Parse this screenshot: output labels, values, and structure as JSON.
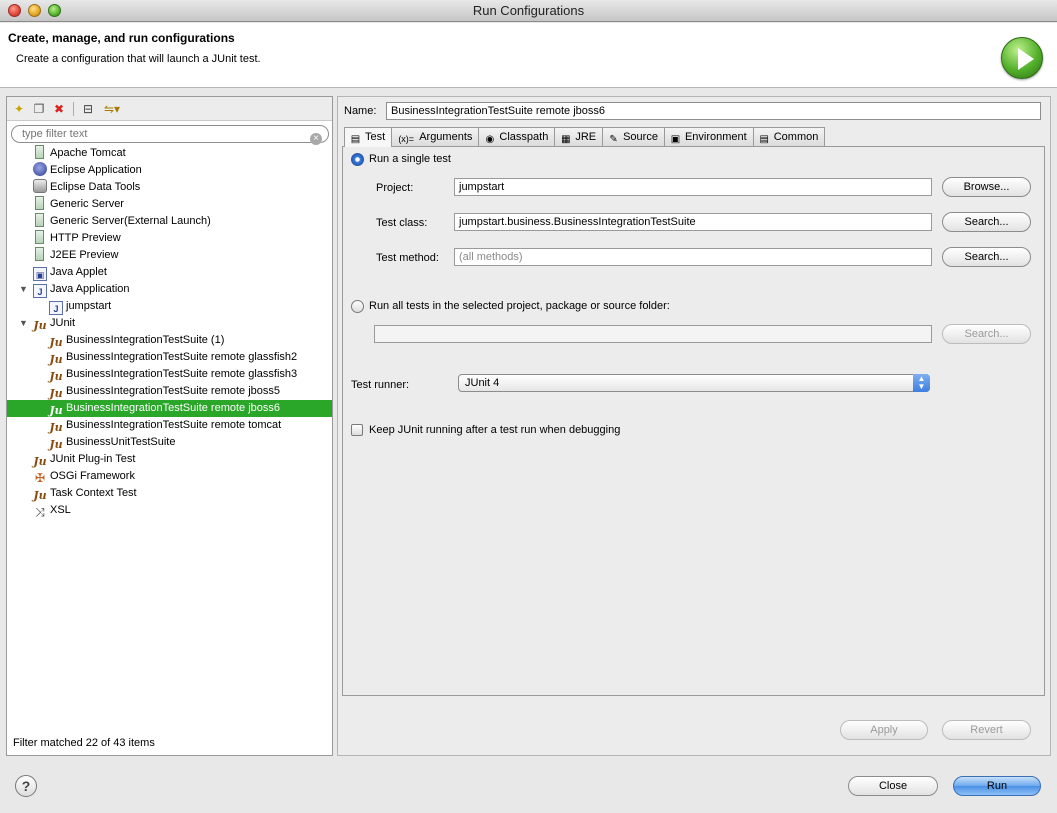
{
  "window": {
    "title": "Run Configurations"
  },
  "header": {
    "title": "Create, manage, and run configurations",
    "description": "Create a configuration that will launch a JUnit test."
  },
  "sidebar": {
    "filter_placeholder": "type filter text",
    "items": [
      {
        "label": "Apache Tomcat",
        "icon": "server-icon",
        "level": 0
      },
      {
        "label": "Eclipse Application",
        "icon": "eclipse-icon",
        "level": 0
      },
      {
        "label": "Eclipse Data Tools",
        "icon": "database-icon",
        "level": 0
      },
      {
        "label": "Generic Server",
        "icon": "server-icon",
        "level": 0
      },
      {
        "label": "Generic Server(External Launch)",
        "icon": "server-icon",
        "level": 0
      },
      {
        "label": "HTTP Preview",
        "icon": "server-icon",
        "level": 0
      },
      {
        "label": "J2EE Preview",
        "icon": "server-icon",
        "level": 0
      },
      {
        "label": "Java Applet",
        "icon": "applet-icon",
        "level": 0
      },
      {
        "label": "Java Application",
        "icon": "java-app-icon",
        "level": 0,
        "expanded": true
      },
      {
        "label": "jumpstart",
        "icon": "java-app-icon",
        "level": 1
      },
      {
        "label": "JUnit",
        "icon": "junit-icon",
        "level": 0,
        "expanded": true
      },
      {
        "label": "BusinessIntegrationTestSuite (1)",
        "icon": "junit-icon",
        "level": 1
      },
      {
        "label": "BusinessIntegrationTestSuite remote glassfish2",
        "icon": "junit-icon",
        "level": 1
      },
      {
        "label": "BusinessIntegrationTestSuite remote glassfish3",
        "icon": "junit-icon",
        "level": 1
      },
      {
        "label": "BusinessIntegrationTestSuite remote jboss5",
        "icon": "junit-icon",
        "level": 1
      },
      {
        "label": "BusinessIntegrationTestSuite remote jboss6",
        "icon": "junit-icon",
        "level": 1,
        "selected": true
      },
      {
        "label": "BusinessIntegrationTestSuite remote tomcat",
        "icon": "junit-icon",
        "level": 1
      },
      {
        "label": "BusinessUnitTestSuite",
        "icon": "junit-icon",
        "level": 1
      },
      {
        "label": "JUnit Plug-in Test",
        "icon": "junit-plugin-icon",
        "level": 0
      },
      {
        "label": "OSGi Framework",
        "icon": "osgi-icon",
        "level": 0
      },
      {
        "label": "Task Context Test",
        "icon": "junit-icon",
        "level": 0
      },
      {
        "label": "XSL",
        "icon": "xsl-icon",
        "level": 0
      }
    ],
    "status": "Filter matched 22 of 43 items"
  },
  "config": {
    "name_label": "Name:",
    "name_value": "BusinessIntegrationTestSuite remote jboss6",
    "tabs": [
      {
        "label": "Test",
        "icon": "test-tab-icon",
        "active": true
      },
      {
        "label": "Arguments",
        "icon": "arguments-icon"
      },
      {
        "label": "Classpath",
        "icon": "classpath-icon"
      },
      {
        "label": "JRE",
        "icon": "jre-icon"
      },
      {
        "label": "Source",
        "icon": "source-icon"
      },
      {
        "label": "Environment",
        "icon": "environment-icon"
      },
      {
        "label": "Common",
        "icon": "common-icon"
      }
    ],
    "test": {
      "run_single_label": "Run a single test",
      "project_label": "Project:",
      "project_value": "jumpstart",
      "browse_label": "Browse...",
      "class_label": "Test class:",
      "class_value": "jumpstart.business.BusinessIntegrationTestSuite",
      "search_label": "Search...",
      "method_label": "Test method:",
      "method_placeholder": "(all methods)",
      "run_all_label": "Run all tests in the selected project, package or source folder:",
      "runner_label": "Test runner:",
      "runner_value": "JUnit 4",
      "keep_running_label": "Keep JUnit running after a test run when debugging"
    },
    "apply_label": "Apply",
    "revert_label": "Revert"
  },
  "footer": {
    "help_symbol": "?",
    "close_label": "Close",
    "run_label": "Run"
  }
}
